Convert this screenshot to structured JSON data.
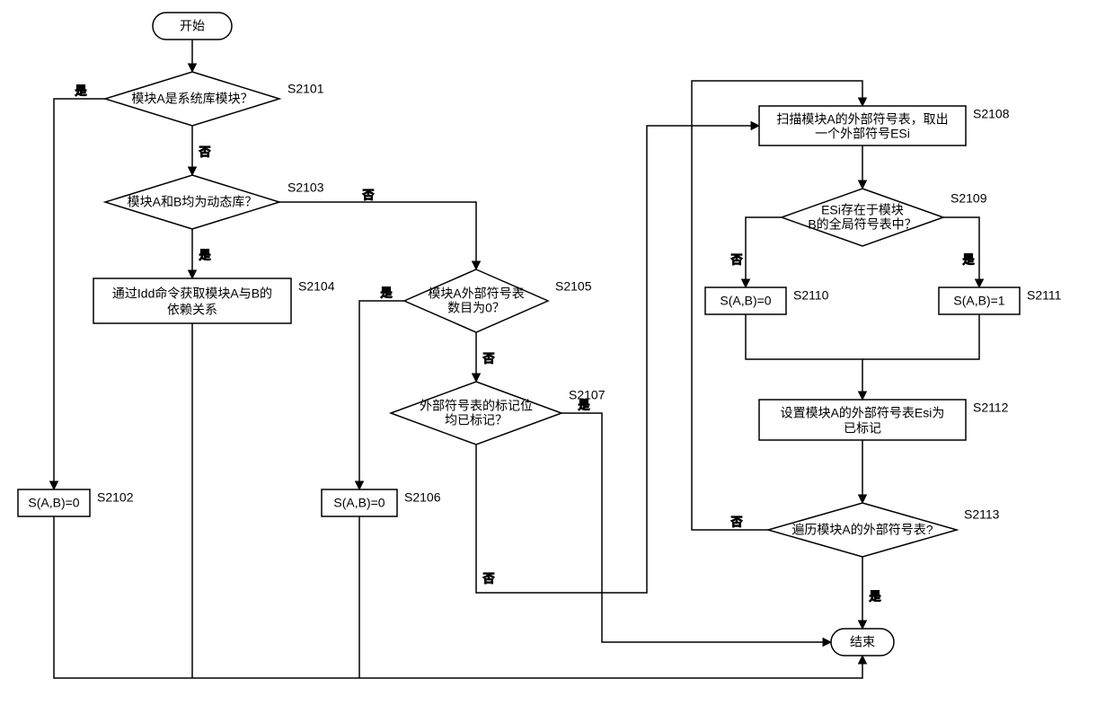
{
  "chart_data": {
    "type": "flowchart",
    "nodes": [
      {
        "id": "start",
        "shape": "terminator",
        "text": "开始"
      },
      {
        "id": "S2101",
        "shape": "decision",
        "text": "模块A是系统库模块？",
        "label": "S2101"
      },
      {
        "id": "S2102",
        "shape": "process",
        "text": "S(A,B)=0",
        "label": "S2102"
      },
      {
        "id": "S2103",
        "shape": "decision",
        "text": "模块A和B均为动态库？",
        "label": "S2103"
      },
      {
        "id": "S2104",
        "shape": "process",
        "text": "通过Idd命令获取模块A与B的依赖关系",
        "label": "S2104"
      },
      {
        "id": "S2105",
        "shape": "decision",
        "text": "模块A外部符号表数目为0？",
        "label": "S2105"
      },
      {
        "id": "S2106",
        "shape": "process",
        "text": "S(A,B)=0",
        "label": "S2106"
      },
      {
        "id": "S2107",
        "shape": "decision",
        "text": "外部符号表的标记位均已标记？",
        "label": "S2107"
      },
      {
        "id": "S2108",
        "shape": "process",
        "text": "扫描模块A的外部符号表，取出一个外部符号ESi",
        "label": "S2108"
      },
      {
        "id": "S2109",
        "shape": "decision",
        "text": "ESi存在于模块B的全局符号表中？",
        "label": "S2109"
      },
      {
        "id": "S2110",
        "shape": "process",
        "text": "S(A,B)=0",
        "label": "S2110"
      },
      {
        "id": "S2111",
        "shape": "process",
        "text": "S(A,B)=1",
        "label": "S2111"
      },
      {
        "id": "S2112",
        "shape": "process",
        "text": "设置模块A的外部符号表Esi为已标记",
        "label": "S2112"
      },
      {
        "id": "S2113",
        "shape": "decision",
        "text": "遍历模块A的外部符号表?",
        "label": "S2113"
      },
      {
        "id": "end",
        "shape": "terminator",
        "text": "结束"
      }
    ],
    "edges": [
      {
        "from": "start",
        "to": "S2101"
      },
      {
        "from": "S2101",
        "to": "S2102",
        "label": "是"
      },
      {
        "from": "S2101",
        "to": "S2103",
        "label": "否"
      },
      {
        "from": "S2103",
        "to": "S2104",
        "label": "是"
      },
      {
        "from": "S2103",
        "to": "S2105",
        "label": "否"
      },
      {
        "from": "S2105",
        "to": "S2106",
        "label": "是"
      },
      {
        "from": "S2105",
        "to": "S2107",
        "label": "否"
      },
      {
        "from": "S2107",
        "to": "S2108",
        "label": "否"
      },
      {
        "from": "S2107",
        "to": "end",
        "label": "是"
      },
      {
        "from": "S2108",
        "to": "S2109"
      },
      {
        "from": "S2109",
        "to": "S2110",
        "label": "否"
      },
      {
        "from": "S2109",
        "to": "S2111",
        "label": "是"
      },
      {
        "from": "S2110",
        "to": "S2112"
      },
      {
        "from": "S2111",
        "to": "S2112"
      },
      {
        "from": "S2112",
        "to": "S2113"
      },
      {
        "from": "S2113",
        "to": "S2108",
        "label": "否"
      },
      {
        "from": "S2113",
        "to": "end",
        "label": "是"
      },
      {
        "from": "S2102",
        "to": "end"
      },
      {
        "from": "S2104",
        "to": "end"
      },
      {
        "from": "S2106",
        "to": "end"
      }
    ]
  },
  "start": "开始",
  "end": "结束",
  "yes": "是",
  "no": "否",
  "S2101": {
    "text": "模块A是系统库模块？",
    "label": "S2101"
  },
  "S2102": {
    "text": "S(A,B)=0",
    "label": "S2102"
  },
  "S2103": {
    "text": "模块A和B均为动态库？",
    "label": "S2103"
  },
  "S2104": {
    "text1": "通过Idd命令获取模块A与B的",
    "text2": "依赖关系",
    "label": "S2104"
  },
  "S2105": {
    "text1": "模块A外部符号表",
    "text2": "数目为0？",
    "label": "S2105"
  },
  "S2106": {
    "text": "S(A,B)=0",
    "label": "S2106"
  },
  "S2107": {
    "text1": "外部符号表的标记位",
    "text2": "均已标记？",
    "label": "S2107"
  },
  "S2108": {
    "text1": "扫描模块A的外部符号表，取出",
    "text2": "一个外部符号ESi",
    "label": "S2108"
  },
  "S2109": {
    "text1": "ESi存在于模块",
    "text2": "B的全局符号表中？",
    "label": "S2109"
  },
  "S2110": {
    "text": "S(A,B)=0",
    "label": "S2110"
  },
  "S2111": {
    "text": "S(A,B)=1",
    "label": "S2111"
  },
  "S2112": {
    "text1": "设置模块A的外部符号表Esi为",
    "text2": "已标记",
    "label": "S2112"
  },
  "S2113": {
    "text": "遍历模块A的外部符号表?",
    "label": "S2113"
  }
}
